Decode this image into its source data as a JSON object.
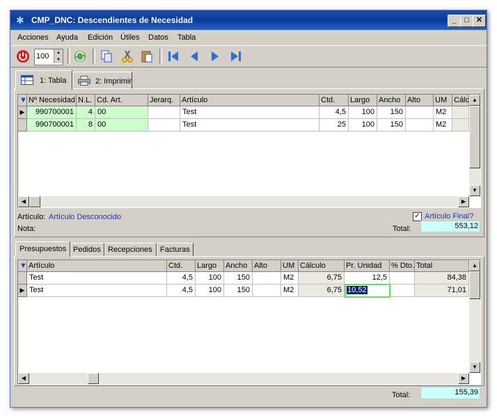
{
  "window": {
    "title": "CMP_DNC: Descendientes de Necesidad",
    "buttons": {
      "minimize": "_",
      "maximize": "□",
      "close": "✕"
    }
  },
  "menu": [
    {
      "label": "Acciones"
    },
    {
      "label": "Ayuda"
    },
    {
      "label": "Edición"
    },
    {
      "label": "Útiles"
    },
    {
      "label": "Datos"
    },
    {
      "label": "Tabla"
    }
  ],
  "toolbar": {
    "spin_value": "100"
  },
  "top_tabs": [
    {
      "label": "1: Tabla"
    },
    {
      "label": "2: Imprimir"
    }
  ],
  "grid1": {
    "headers": [
      "Nº Necesidad",
      "N.L.",
      "Cd. Art.",
      "Jerarq.",
      "Artículo",
      "Ctd.",
      "Largo",
      "Ancho",
      "Alto",
      "UM",
      "Cálc"
    ],
    "rows": [
      [
        "990700001",
        "4",
        "00",
        "",
        "Test",
        "4,5",
        "100",
        "150",
        "",
        "M2",
        ""
      ],
      [
        "990700001",
        "8",
        "00",
        "",
        "Test",
        "25",
        "100",
        "150",
        "",
        "M2",
        ""
      ]
    ]
  },
  "info": {
    "articulo_label": "Artículo:",
    "articulo_value": "Artículo Desconocido",
    "nota_label": "Nota:",
    "final_label": "Artículo Final?",
    "total_label": "Total:",
    "total_value": "553,12"
  },
  "bottom_tabs": [
    {
      "label": "Presupuestos"
    },
    {
      "label": "Pedidos"
    },
    {
      "label": "Recepciones"
    },
    {
      "label": "Facturas"
    }
  ],
  "grid2": {
    "headers": [
      "Artículo",
      "Ctd.",
      "Largo",
      "Ancho",
      "Alto",
      "UM",
      "Cálculo",
      "Pr. Unidad",
      "% Dto.",
      "Total"
    ],
    "rows": [
      [
        "Test",
        "4,5",
        "100",
        "150",
        "",
        "M2",
        "6,75",
        "12,5",
        "",
        "84,38"
      ],
      [
        "Test",
        "4,5",
        "100",
        "150",
        "",
        "M2",
        "6,75",
        "10,52",
        "",
        "71,01"
      ]
    ]
  },
  "footer": {
    "total_label": "Total:",
    "total_value": "155,39"
  }
}
